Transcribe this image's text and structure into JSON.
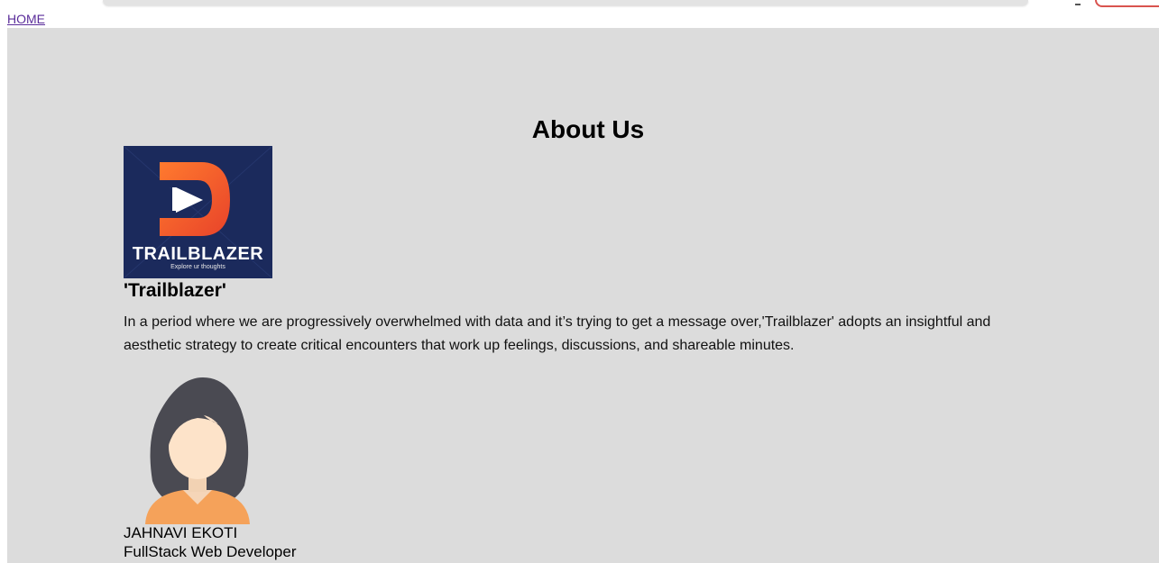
{
  "nav": {
    "home_label": "HOME"
  },
  "about": {
    "title": "About Us",
    "logo": {
      "name": "TRAILBLAZER",
      "tagline": "Explore ur thoughts",
      "background_color": "#1b2a5c",
      "accent_color": "#f26a2e"
    },
    "brand_name": "'Trailblazer'",
    "description": "In a period where we are progressively overwhelmed with data and it’s trying to get a message over,'Trailblazer' adopts an insightful and aesthetic strategy to create critical encounters that work up feelings, discussions, and shareable minutes."
  },
  "team": [
    {
      "name": "JAHNAVI EKOTI",
      "role": "FullStack Web Developer",
      "avatar_icon": "female-avatar-icon"
    }
  ]
}
